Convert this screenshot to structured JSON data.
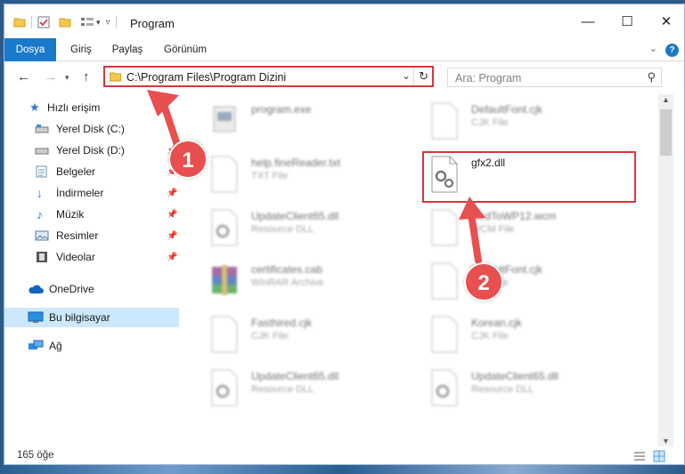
{
  "window": {
    "title": "Program",
    "controls": {
      "minimize": "—",
      "maximize": "☐",
      "close": "✕"
    }
  },
  "ribbon": {
    "tabs": [
      "Dosya",
      "Giriş",
      "Paylaş",
      "Görünüm"
    ],
    "help_label": "?"
  },
  "nav": {
    "address": "C:\\Program Files\\Program Dizini",
    "search_placeholder": "Ara: Program"
  },
  "sidebar": {
    "items": [
      {
        "label": "Hızlı erişim",
        "icon": "star-icon"
      },
      {
        "label": "Yerel Disk (C:)",
        "icon": "drive-icon"
      },
      {
        "label": "Yerel Disk (D:)",
        "icon": "drive-icon"
      },
      {
        "label": "Belgeler",
        "icon": "documents-icon"
      },
      {
        "label": "İndirmeler",
        "icon": "download-icon"
      },
      {
        "label": "Müzik",
        "icon": "music-icon"
      },
      {
        "label": "Resimler",
        "icon": "pictures-icon"
      },
      {
        "label": "Videolar",
        "icon": "video-icon"
      },
      {
        "label": "OneDrive",
        "icon": "cloud-icon"
      },
      {
        "label": "Bu bilgisayar",
        "icon": "computer-icon"
      },
      {
        "label": "Ağ",
        "icon": "network-icon"
      }
    ]
  },
  "files": {
    "left": [
      {
        "name": "program.exe",
        "type": ""
      },
      {
        "name": "help.fineReader.txt",
        "type": "TXT File"
      },
      {
        "name": "UpdateClient65.dll",
        "type": "Resource DLL"
      },
      {
        "name": "certificates.cab",
        "type": "WinRAR Archive"
      },
      {
        "name": "Fasthired.cjk",
        "type": "CJK File"
      },
      {
        "name": "UpdateClient65.dll",
        "type": "Resource DLL"
      }
    ],
    "right": [
      {
        "name": "DefaultFont.cjk",
        "type": "CJK File"
      },
      {
        "name": "gfx2.dll",
        "type": ""
      },
      {
        "name": "RedToWP12.wcm",
        "type": "WCM File"
      },
      {
        "name": "DefaultFont.cjk",
        "type": "CJK File"
      },
      {
        "name": "Korean.cjk",
        "type": "CJK File"
      },
      {
        "name": "UpdateClient65.dll",
        "type": "Resource DLL"
      }
    ]
  },
  "status": {
    "count": "165 öğe"
  },
  "annotations": {
    "step1": "1",
    "step2": "2"
  },
  "colors": {
    "accent": "#1979ca",
    "highlight": "#d9363e",
    "badge": "#e84f4f"
  }
}
